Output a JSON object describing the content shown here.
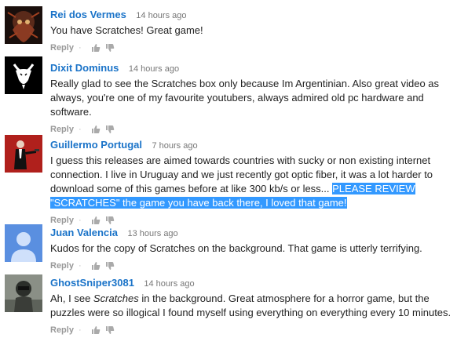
{
  "comments": [
    {
      "author": "Rei dos Vermes",
      "time": "14 hours ago",
      "text": "You have Scratches! Great game!",
      "reply": "Reply"
    },
    {
      "author": "Dixit Dominus",
      "time": "14 hours ago",
      "text": "Really glad to see the Scratches box only because Im Argentinian. Also great video as always, you're one of my favourite youtubers, always admired old pc hardware and software.",
      "reply": "Reply"
    },
    {
      "author": "Guillermo Portugal",
      "time": "7 hours ago",
      "text_plain": "I guess this releases are aimed towards countries with sucky or non existing internet connection. I live in Uruguay and we just recently got optic fiber, it was a lot harder to download some of this games before at like 300 kb/s or less... ",
      "text_highlight": "PLEASE REVIEW \"SCRATCHES\" the game you have back there, I loved that game!",
      "reply": "Reply"
    },
    {
      "author": "Juan Valencia",
      "time": "13 hours ago",
      "text": "Kudos for the copy of Scratches on the background. That game is utterly terrifying.",
      "reply": "Reply"
    },
    {
      "author": "GhostSniper3081",
      "time": "14 hours ago",
      "text_before": "Ah, I see ",
      "text_em": "Scratches",
      "text_after": " in the background. Great atmosphere for a horror game, but the puzzles were so illogical I found myself using everything on everything every 10 minutes.",
      "reply": "Reply"
    }
  ],
  "icons": {
    "like": "thumbs-up-icon",
    "dislike": "thumbs-down-icon"
  },
  "colors": {
    "author": "#1a73c8",
    "highlight": "#3399ff",
    "meta": "#777777"
  }
}
